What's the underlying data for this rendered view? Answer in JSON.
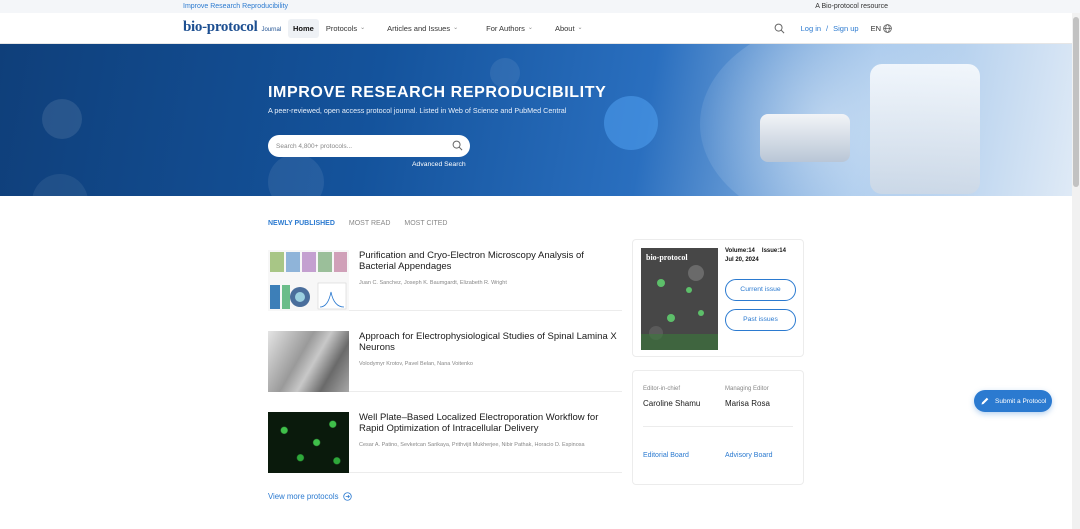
{
  "topstrip": {
    "left_link": "Improve Research Reproducibility",
    "right_text": "A Bio-protocol resource"
  },
  "logo": {
    "main": "bio-protocol",
    "sub": "Journal"
  },
  "nav": {
    "items": [
      {
        "label": "Home",
        "active": true,
        "dropdown": false
      },
      {
        "label": "Protocols",
        "active": false,
        "dropdown": true
      },
      {
        "label": "Articles and Issues",
        "active": false,
        "dropdown": true
      },
      {
        "label": "For Authors",
        "active": false,
        "dropdown": true
      },
      {
        "label": "About",
        "active": false,
        "dropdown": true
      }
    ],
    "login": "Log in",
    "separator": "/",
    "signup": "Sign up",
    "lang": "EN"
  },
  "hero": {
    "title": "IMPROVE RESEARCH REPRODUCIBILITY",
    "subtitle": "A peer-reviewed, open access protocol journal. Listed in Web of Science and PubMed Central",
    "search_placeholder": "Search 4,800+ protocols...",
    "advanced_search": "Advanced Search"
  },
  "tabs": [
    {
      "label": "NEWLY PUBLISHED",
      "active": true
    },
    {
      "label": "MOST READ",
      "active": false
    },
    {
      "label": "MOST CITED",
      "active": false
    }
  ],
  "articles": [
    {
      "title": "Purification and Cryo-Electron Microscopy Analysis of Bacterial Appendages",
      "authors": "Juan C. Sanchez, Joseph K. Baumgardt, Elizabeth R. Wright"
    },
    {
      "title": "Approach for Electrophysiological Studies of Spinal Lamina X Neurons",
      "authors": "Volodymyr Krotov, Pavel Belan, Nana Voitenko"
    },
    {
      "title": "Well Plate–Based Localized Electroporation Workflow for Rapid Optimization of Intracellular Delivery",
      "authors": "Cesar A. Patino, Sevketcan Sarikaya, Prithvijit Mukherjee, Nibir Pathak, Horacio D. Espinosa"
    }
  ],
  "view_more": "View more protocols",
  "issue": {
    "cover_title": "bio-protocol",
    "volume": "Volume:14",
    "issue": "Issue:14",
    "date": "Jul 20, 2024",
    "current_issue": "Current issue",
    "past_issues": "Past issues"
  },
  "editors": {
    "chief_label": "Editor-in-chief",
    "chief_name": "Caroline Shamu",
    "managing_label": "Managing Editor",
    "managing_name": "Marisa Rosa",
    "editorial_board": "Editorial Board",
    "advisory_board": "Advisory Board"
  },
  "submit": {
    "label": "Submit a Protocol"
  },
  "colors": {
    "accent": "#2b7ad0",
    "hero_dark": "#0f3f7a",
    "brand": "#1d4f91"
  }
}
